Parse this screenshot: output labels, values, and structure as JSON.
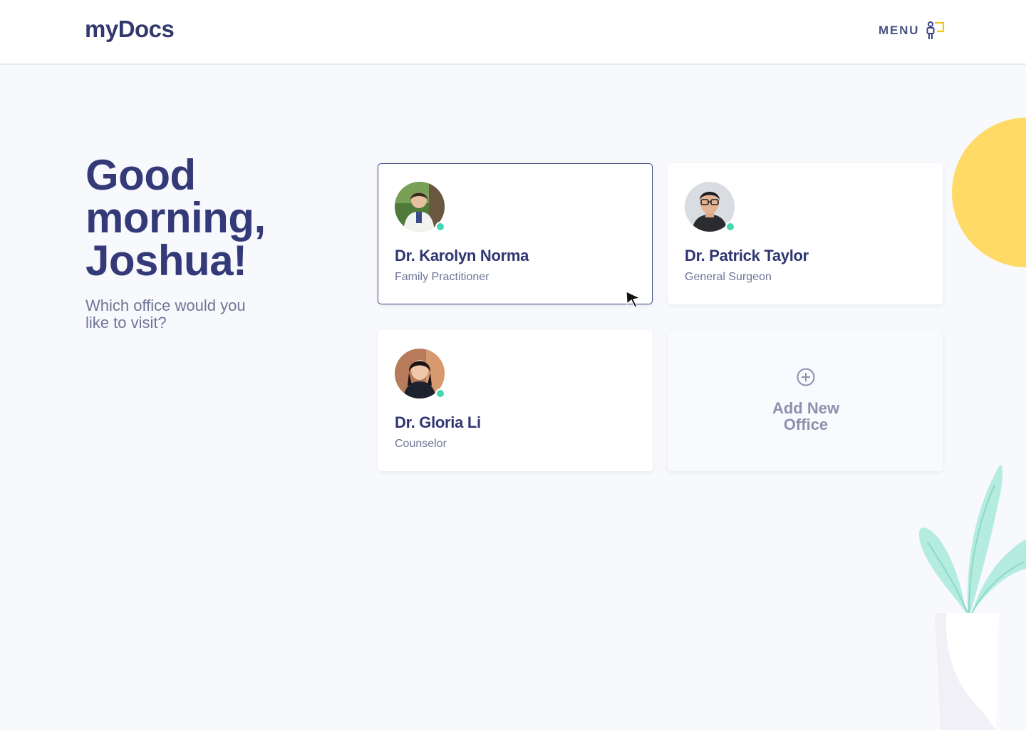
{
  "header": {
    "logo": "myDocs",
    "menu_label": "MENU",
    "menu_icon": "person-chat-icon"
  },
  "greeting": {
    "title": "Good morning, Joshua!",
    "subtitle": "Which office would you like to visit?"
  },
  "offices": [
    {
      "name": "Dr. Karolyn Norma",
      "role": "Family Practitioner",
      "online": true,
      "selected": true
    },
    {
      "name": "Dr. Patrick Taylor",
      "role": "General Surgeon",
      "online": true,
      "selected": false
    },
    {
      "name": "Dr. Gloria Li",
      "role": "Counselor",
      "online": true,
      "selected": false
    }
  ],
  "add_office": {
    "line1": "Add New",
    "line2": "Office",
    "icon": "plus-circle-icon"
  },
  "colors": {
    "primary": "#33396e",
    "muted": "#6f7596",
    "online": "#45d6b3",
    "accent_yellow": "#ffda66",
    "plant": "#b5ece0",
    "background": "#f8f9fd"
  }
}
